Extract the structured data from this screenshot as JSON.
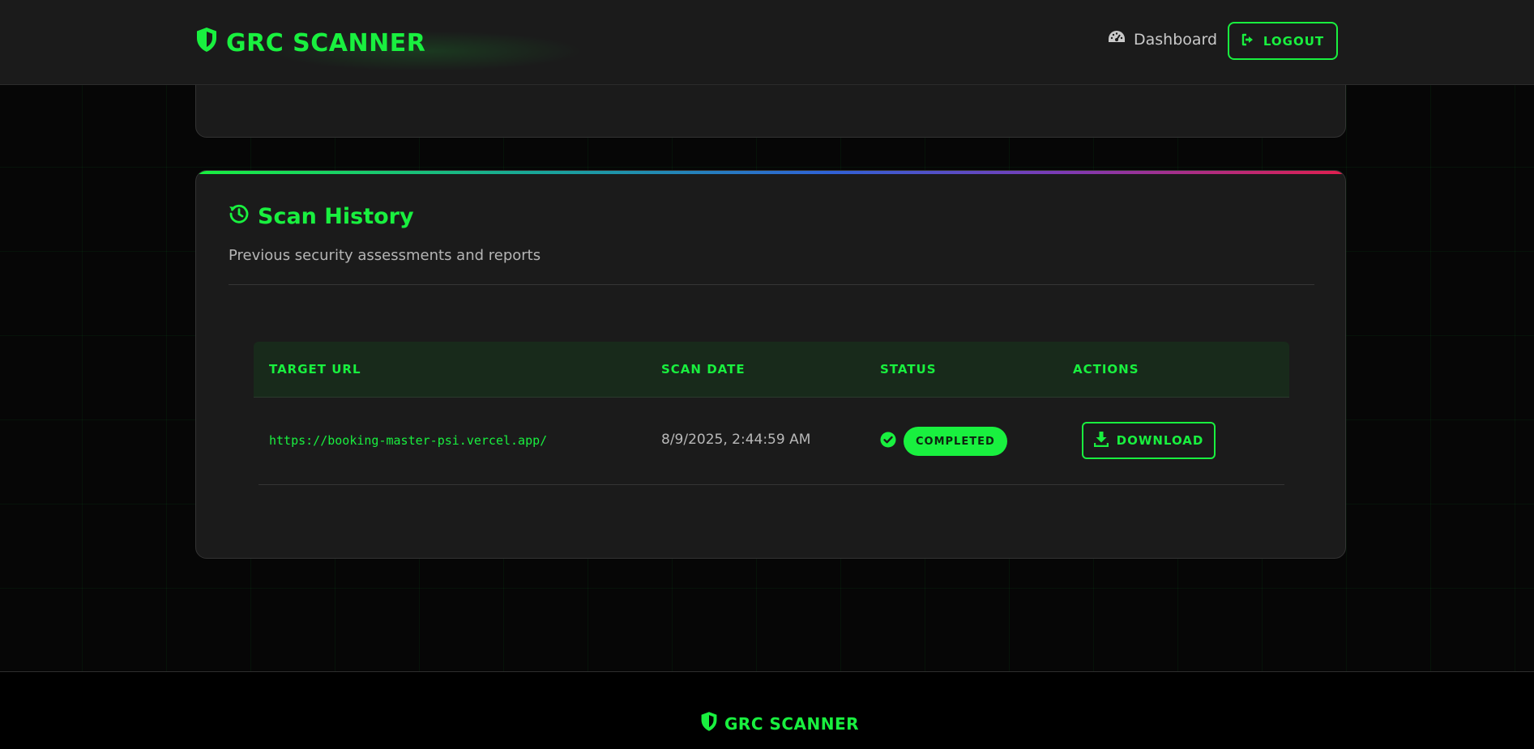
{
  "header": {
    "brand": "GRC SCANNER",
    "brand_icon": "shield-icon",
    "nav": {
      "dashboard_label": "Dashboard",
      "dashboard_icon": "gauge-icon"
    },
    "logout_label": "LOGOUT",
    "logout_icon": "sign-out-icon"
  },
  "history": {
    "title": "Scan History",
    "title_icon": "history-icon",
    "subtitle": "Previous security assessments and reports",
    "columns": [
      "TARGET URL",
      "SCAN DATE",
      "STATUS",
      "ACTIONS"
    ],
    "rows": [
      {
        "url": "https://booking-master-psi.vercel.app/",
        "date": "8/9/2025, 2:44:59 AM",
        "status": "COMPLETED",
        "status_icon": "check-circle-icon",
        "action": "DOWNLOAD",
        "action_icon": "download-icon"
      }
    ]
  },
  "footer": {
    "brand": "GRC SCANNER",
    "brand_icon": "shield-icon"
  },
  "colors": {
    "accent": "#19f03f",
    "background": "#060606",
    "card": "#1b1b1b",
    "table_header": "#182a1b",
    "gradient": [
      "#19f03f",
      "#19a59a",
      "#2f62d6",
      "#7b3bb5",
      "#e01f4f"
    ]
  }
}
